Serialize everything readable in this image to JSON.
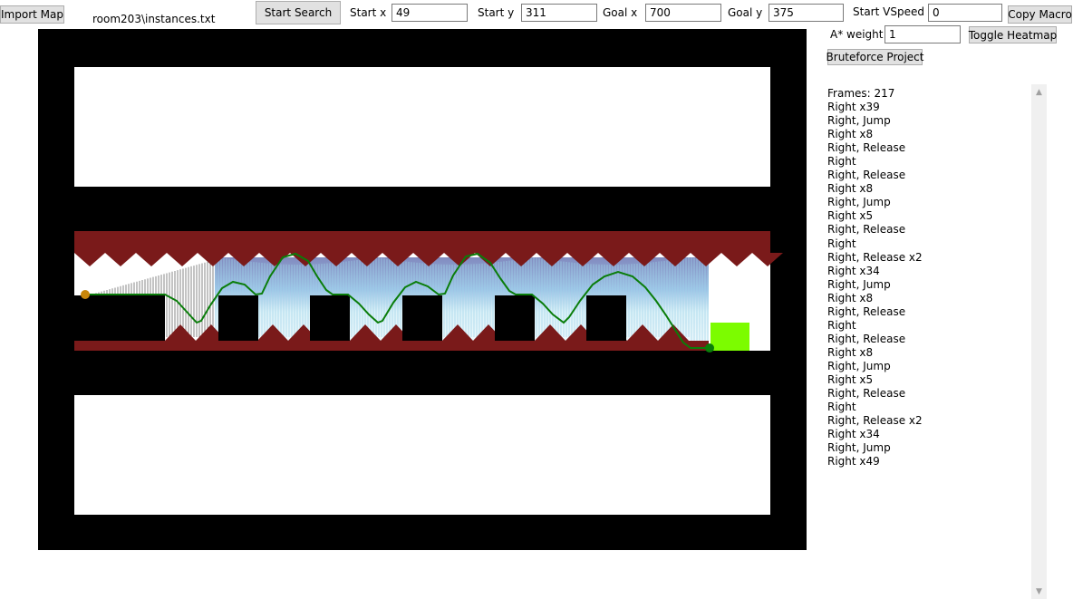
{
  "toolbar": {
    "import_label": "Import Map",
    "map_path": "room203\\instances.txt",
    "start_search_label": "Start Search",
    "start_x_label": "Start x",
    "start_x_value": "49",
    "start_y_label": "Start y",
    "start_y_value": "311",
    "goal_x_label": "Goal x",
    "goal_x_value": "700",
    "goal_y_label": "Goal y",
    "goal_y_value": "375",
    "vspeed_label": "Start VSpeed",
    "vspeed_value": "0",
    "copy_macro_label": "Copy Macro",
    "astar_label": "A* weight",
    "astar_value": "1",
    "heatmap_label": "Toggle Heatmap",
    "bruteforce_label": "Bruteforce Project"
  },
  "colors": {
    "wall": "#000000",
    "spike": "#7a1a1a",
    "path": "#0a7d0a",
    "start_marker": "#c8860a",
    "goal_block": "#7cfc00"
  },
  "output": {
    "frames": "Frames: 217",
    "lines": [
      "Right x39",
      "Right, Jump",
      "Right x8",
      "Right, Release",
      "Right",
      "Right, Release",
      "Right x8",
      "Right, Jump",
      "Right x5",
      "Right, Release",
      "Right",
      "Right, Release x2",
      "Right x34",
      "Right, Jump",
      "Right x8",
      "Right, Release",
      "Right",
      "Right, Release",
      "Right x8",
      "Right, Jump",
      "Right x5",
      "Right, Release",
      "Right",
      "Right, Release x2",
      "Right x34",
      "Right, Jump",
      "Right x49"
    ]
  }
}
